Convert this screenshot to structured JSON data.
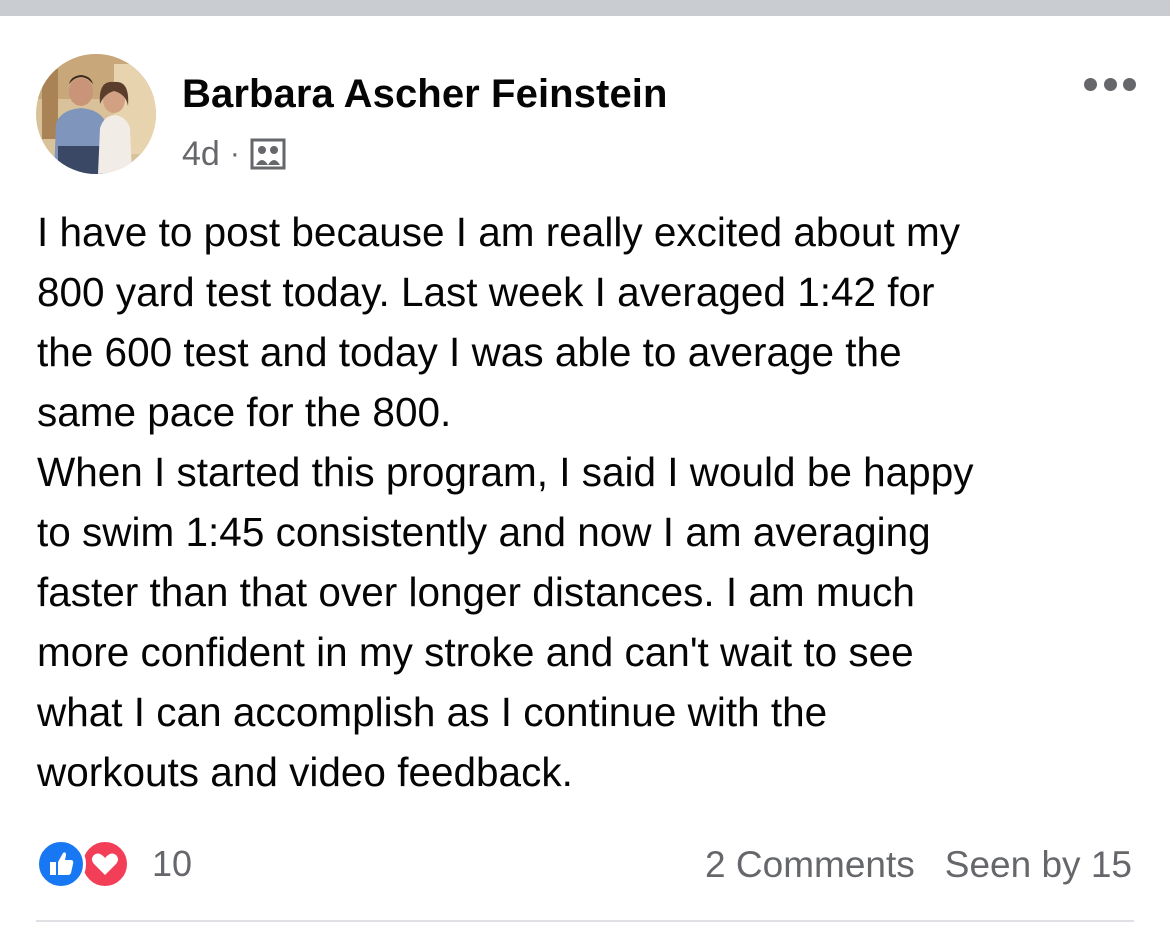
{
  "post": {
    "author_name": "Barbara Ascher Feinstein",
    "timestamp": "4d",
    "separator": "·",
    "audience_icon": "group-photo-icon",
    "more_icon": "more-options-icon",
    "body_lines": [
      "I have to post because I am really excited about my",
      "800 yard test today. Last week I averaged 1:42 for",
      "the 600 test and today I was able to average the",
      "same pace for the 800.",
      "When I started this program, I said I would be happy",
      "to swim 1:45 consistently and now I am averaging",
      "faster than that over longer distances. I am much",
      "more confident in my stroke and can't wait to see",
      "what I can accomplish as I continue with the",
      "workouts and video feedback."
    ]
  },
  "footer": {
    "reaction_icons": [
      "like-icon",
      "love-icon"
    ],
    "reaction_count": "10",
    "comments_label": "2 Comments",
    "seen_label": "Seen by 15"
  },
  "colors": {
    "like": "#1877f2",
    "love": "#f33e58",
    "secondary_text": "#65676b",
    "primary_text": "#050505",
    "top_strip": "#c9ccd1"
  }
}
